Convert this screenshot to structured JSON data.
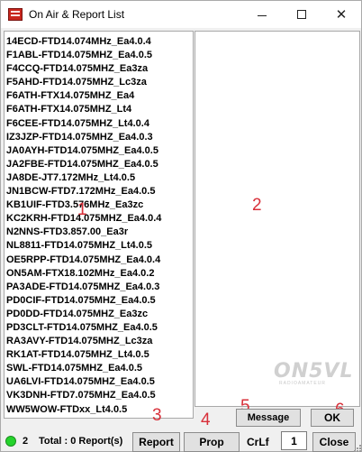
{
  "window": {
    "title": "On Air & Report List"
  },
  "reports": [
    "14ECD-FTD14.074MHz_Ea4.0.4",
    "F1ABL-FTD14.075MHZ_Ea4.0.5",
    "F4CCQ-FTD14.075MHZ_Ea3za",
    "F5AHD-FTD14.075MHZ_Lc3za",
    "F6ATH-FTX14.075MHZ_Ea4",
    "F6ATH-FTX14.075MHZ_Lt4",
    "F6CEE-FTD14.075MHZ_Lt4.0.4",
    "IZ3JZP-FTD14.075MHZ_Ea4.0.3",
    "JA0AYH-FTD14.075MHZ_Ea4.0.5",
    "JA2FBE-FTD14.075MHZ_Ea4.0.5",
    "JA8DE-JT7.172MHz_Lt4.0.5",
    "JN1BCW-FTD7.172MHz_Ea4.0.5",
    "KB1UIF-FTD3.576MHz_Ea3zc",
    "KC2KRH-FTD14.075MHZ_Ea4.0.4",
    "N2NNS-FTD3.857.00_Ea3r",
    "NL8811-FTD14.075MHZ_Lt4.0.5",
    "OE5RPP-FTD14.075MHZ_Ea4.0.4",
    "ON5AM-FTX18.102MHz_Ea4.0.2",
    "PA3ADE-FTD14.075MHZ_Ea4.0.3",
    "PD0CIF-FTD14.075MHZ_Ea4.0.5",
    "PD0DD-FTD14.075MHZ_Ea3zc",
    "PD3CLT-FTD14.075MHZ_Ea4.0.5",
    "RA3AVY-FTD14.075MHZ_Lc3za",
    "RK1AT-FTD14.075MHZ_Lt4.0.5",
    "SWL-FTD14.075MHZ_Ea4.0.5",
    "UA6LVI-FTD14.075MHZ_Ea4.0.5",
    "VK3DNH-FTD7.075MHZ_Ea4.0.5",
    "WW5WOW-FTDxx_Lt4.0.5"
  ],
  "annotations": [
    "1",
    "2",
    "3",
    "4",
    "5",
    "6"
  ],
  "watermark": {
    "main": "ON5VL",
    "sub": "RADIOAMATEUR"
  },
  "buttons": {
    "message": "Message",
    "ok": "OK",
    "report": "Report",
    "prop": "Prop",
    "close": "Close"
  },
  "status": {
    "count": "2",
    "total": "Total : 0 Report(s)",
    "indicator_color": "#25d32c"
  },
  "crlf": {
    "label": "CrLf",
    "value": "1"
  }
}
